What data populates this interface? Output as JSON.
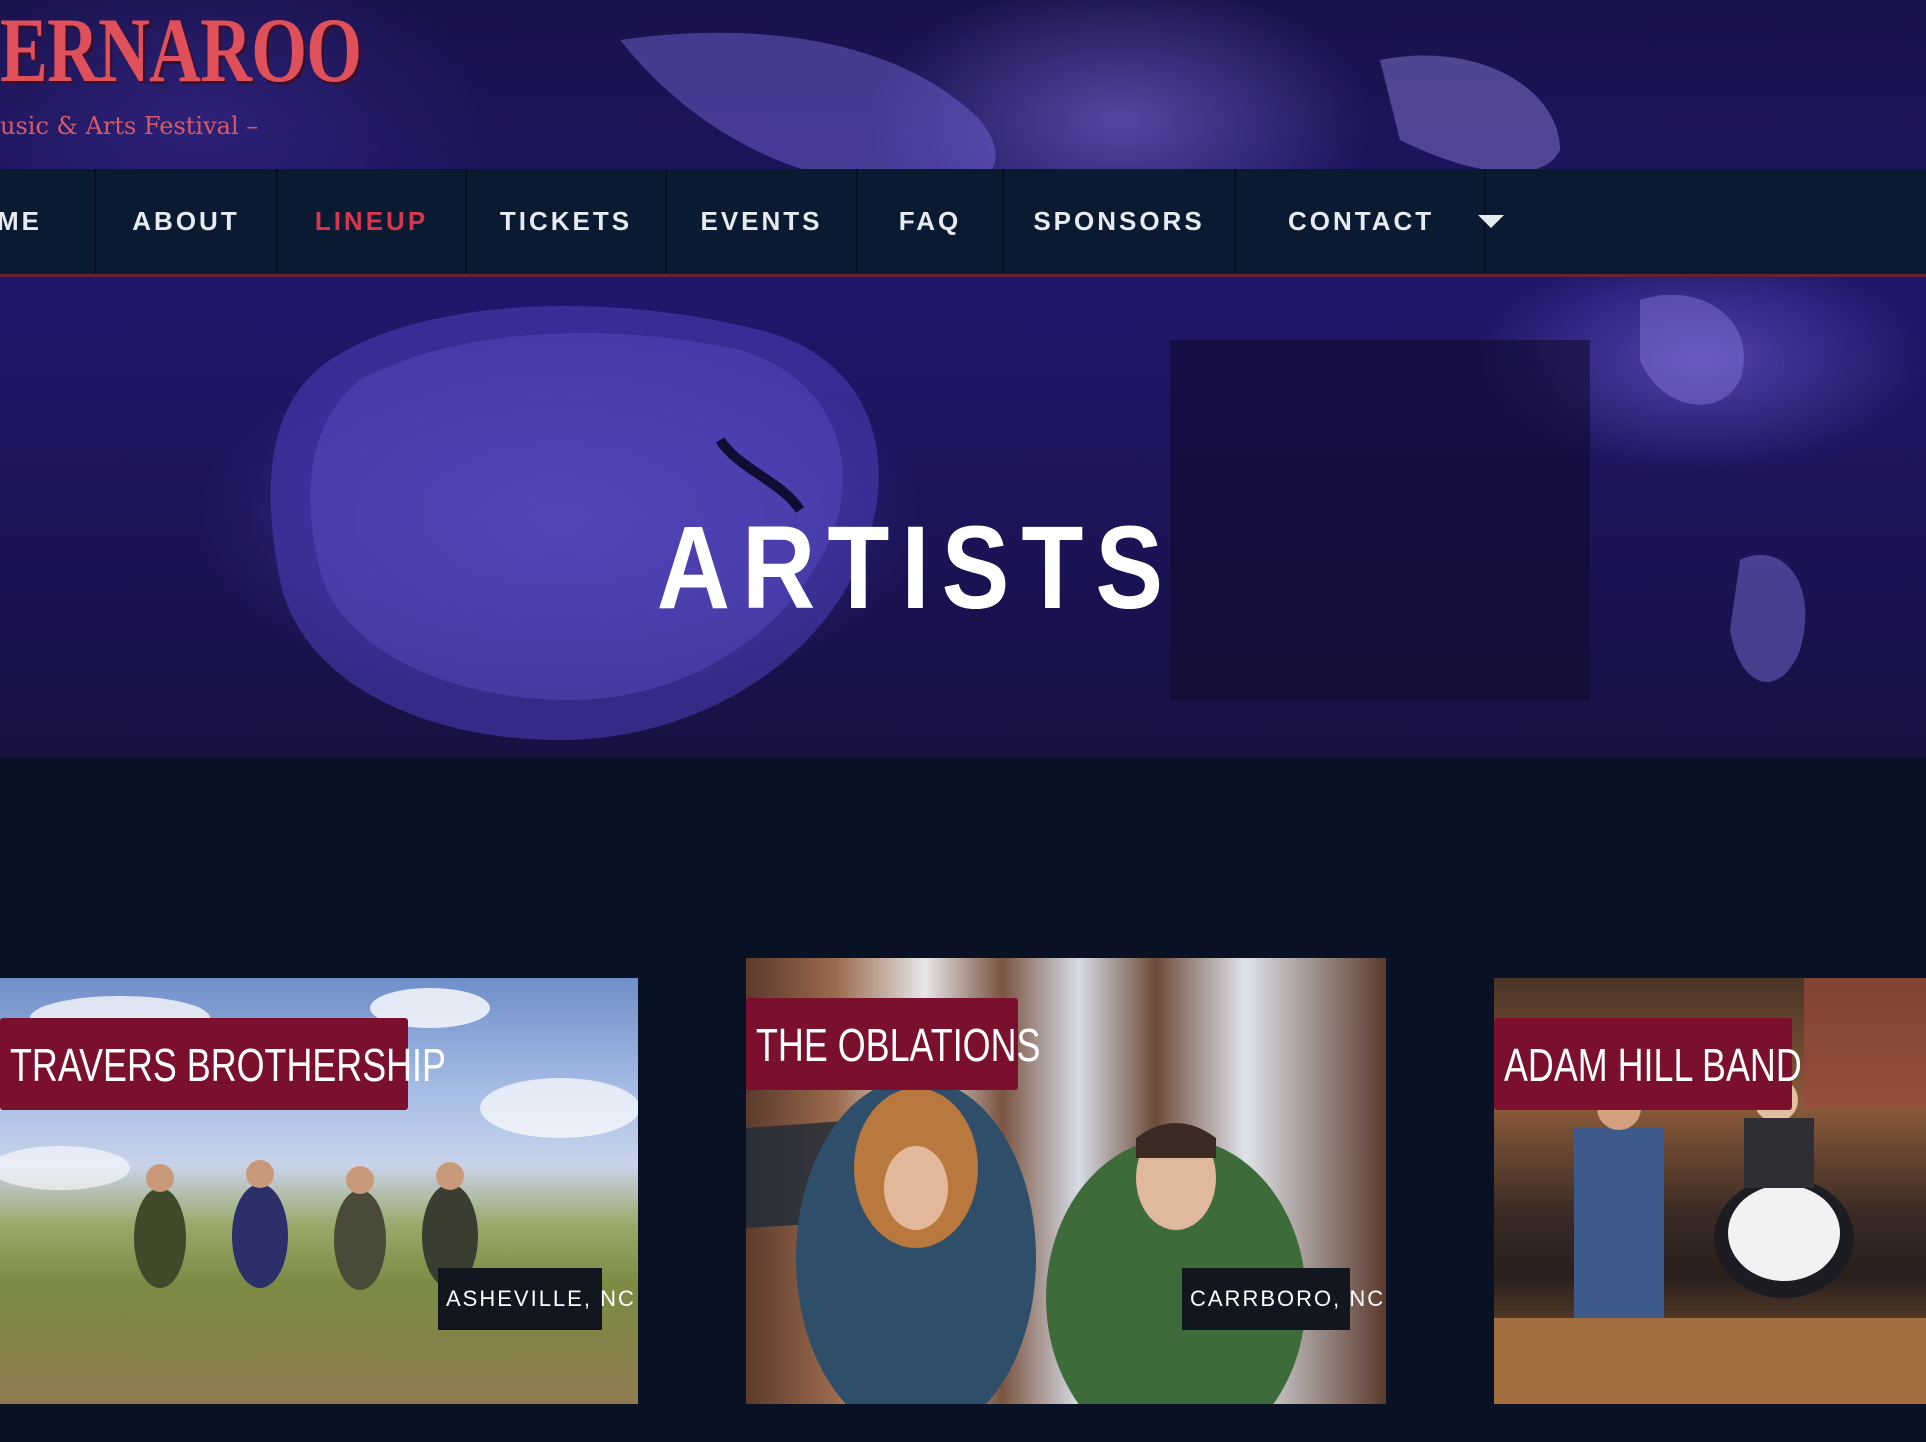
{
  "logo": {
    "title": "ERNAROO",
    "subtitle": "usic & Arts Festival –"
  },
  "nav": {
    "items": [
      {
        "label": "OME"
      },
      {
        "label": "ABOUT"
      },
      {
        "label": "LINEUP"
      },
      {
        "label": "TICKETS"
      },
      {
        "label": "EVENTS"
      },
      {
        "label": "FAQ"
      },
      {
        "label": "SPONSORS"
      },
      {
        "label": "CONTACT"
      }
    ],
    "active": "LINEUP"
  },
  "page": {
    "title": "ARTISTS"
  },
  "artists": [
    {
      "name": "TRAVERS BROTHERSHIP",
      "location": "ASHEVILLE, NC"
    },
    {
      "name": "THE OBLATIONS",
      "location": "CARRBORO, NC"
    },
    {
      "name": "ADAM HILL BAND",
      "location": ""
    }
  ],
  "colors": {
    "page_background": "#081224",
    "nav_background": "#0a1a30",
    "accent_red": "#d8364f",
    "label_maroon": "#7a0f2e"
  }
}
